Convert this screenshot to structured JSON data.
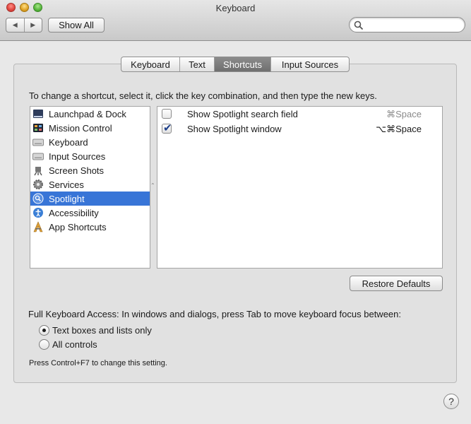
{
  "window": {
    "title": "Keyboard"
  },
  "toolbar": {
    "back_glyph": "◀",
    "forward_glyph": "▶",
    "show_all_label": "Show All",
    "search_value": "",
    "search_placeholder": ""
  },
  "tabs": [
    {
      "label": "Keyboard",
      "selected": false
    },
    {
      "label": "Text",
      "selected": false
    },
    {
      "label": "Shortcuts",
      "selected": true
    },
    {
      "label": "Input Sources",
      "selected": false
    }
  ],
  "instruction": "To change a shortcut, select it, click the key combination, and then type the new keys.",
  "categories": [
    {
      "label": "Launchpad & Dock",
      "icon": "launchpad-icon"
    },
    {
      "label": "Mission Control",
      "icon": "mission-control-icon"
    },
    {
      "label": "Keyboard",
      "icon": "keyboard-icon"
    },
    {
      "label": "Input Sources",
      "icon": "keyboard-icon"
    },
    {
      "label": "Screen Shots",
      "icon": "screenshot-icon"
    },
    {
      "label": "Services",
      "icon": "gear-icon"
    },
    {
      "label": "Spotlight",
      "icon": "spotlight-icon",
      "selected": true
    },
    {
      "label": "Accessibility",
      "icon": "accessibility-icon"
    },
    {
      "label": "App Shortcuts",
      "icon": "app-shortcuts-icon"
    }
  ],
  "shortcuts": [
    {
      "label": "Show Spotlight search field",
      "keys": "⌘Space",
      "checked": false
    },
    {
      "label": "Show Spotlight window",
      "keys": "⌥⌘Space",
      "checked": true
    }
  ],
  "restore_label": "Restore Defaults",
  "full_keyboard_access": "Full Keyboard Access: In windows and dialogs, press Tab to move keyboard focus between:",
  "radio_options": [
    {
      "label": "Text boxes and lists only",
      "selected": true
    },
    {
      "label": "All controls",
      "selected": false
    }
  ],
  "hint": "Press Control+F7 to change this setting.",
  "help_label": "?",
  "colors": {
    "selection": "#3875d7",
    "selected_tab": "#7a7a7a"
  }
}
